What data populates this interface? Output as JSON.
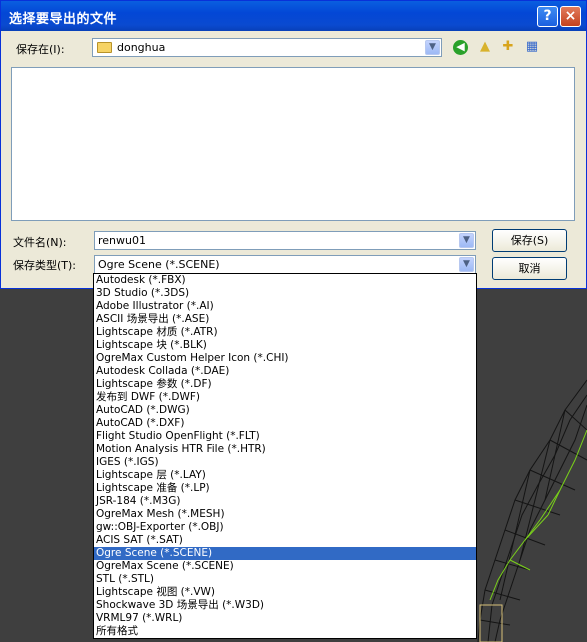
{
  "window": {
    "title": "选择要导出的文件"
  },
  "title_buttons": {
    "help": "?",
    "close": "×"
  },
  "save_in": {
    "label": "保存在(I):",
    "value": "donghua"
  },
  "toolbar_icons": [
    "back-icon",
    "up-folder-icon",
    "new-folder-icon",
    "views-menu-icon"
  ],
  "filename": {
    "label": "文件名(N):",
    "value": "renwu01"
  },
  "filetype": {
    "label": "保存类型(T):",
    "value": "Ogre Scene (*.SCENE)",
    "options": [
      "Autodesk (*.FBX)",
      "3D Studio (*.3DS)",
      "Adobe Illustrator (*.AI)",
      "ASCII 场景导出 (*.ASE)",
      "Lightscape 材质 (*.ATR)",
      "Lightscape 块 (*.BLK)",
      "OgreMax Custom Helper Icon (*.CHI)",
      "Autodesk Collada (*.DAE)",
      "Lightscape 参数 (*.DF)",
      "发布到 DWF (*.DWF)",
      "AutoCAD (*.DWG)",
      "AutoCAD (*.DXF)",
      "Flight Studio OpenFlight (*.FLT)",
      "Motion Analysis HTR File (*.HTR)",
      "IGES (*.IGS)",
      "Lightscape 层 (*.LAY)",
      "Lightscape 准备 (*.LP)",
      "JSR-184 (*.M3G)",
      "OgreMax Mesh (*.MESH)",
      "gw::OBJ-Exporter (*.OBJ)",
      "ACIS SAT (*.SAT)",
      "Ogre Scene (*.SCENE)",
      "OgreMax Scene (*.SCENE)",
      "STL (*.STL)",
      "Lightscape 视图 (*.VW)",
      "Shockwave 3D 场景导出 (*.W3D)",
      "VRML97 (*.WRL)",
      "所有格式"
    ],
    "selected_index": 21
  },
  "buttons": {
    "save": "保存(S)",
    "cancel": "取消"
  },
  "colors": {
    "titlebar": "#0a4ad0",
    "selection": "#316ac5",
    "dialog_bg": "#ece9d8",
    "viewport_bg": "#3f3f3f",
    "wireframe": "#1a1a1a",
    "wireframe_highlight": "#7ad11a"
  }
}
